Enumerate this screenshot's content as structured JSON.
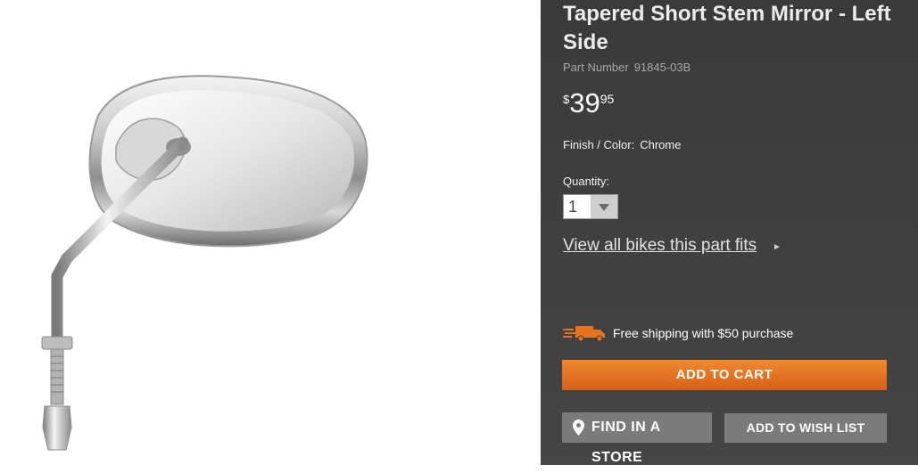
{
  "product": {
    "title": "Tapered Short Stem Mirror - Left Side",
    "part_label": "Part Number",
    "part_number": "91845-03B",
    "price": {
      "currency": "$",
      "dollars": "39",
      "cents": "95"
    },
    "finish_label": "Finish / Color:",
    "finish_value": "Chrome",
    "quantity_label": "Quantity:",
    "quantity_value": "1",
    "bikes_link": "View all bikes this part fits",
    "shipping_text": "Free shipping with $50 purchase"
  },
  "actions": {
    "add_to_cart": "ADD TO CART",
    "find_in_store": "FIND IN A STORE",
    "add_to_wish_list": "ADD TO WISH LIST"
  },
  "colors": {
    "panel_bg": "#3f3f3f",
    "accent_orange": "#e8731f",
    "button_gray": "#7b7b7b"
  },
  "icons": {
    "shipping": "delivery-truck-icon",
    "store": "map-pin-icon",
    "quantity_dropdown": "chevron-down-icon",
    "bikes_link_arrow": "chevron-right-icon"
  }
}
